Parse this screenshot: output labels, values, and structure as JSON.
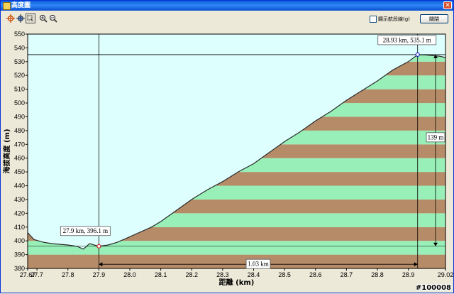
{
  "window": {
    "title": "高度圖",
    "close_glyph": "✕"
  },
  "toolbar": {
    "icons": [
      "crosshair-icon",
      "move-icon",
      "select-icon",
      "zoom-in-icon",
      "zoom-out-icon"
    ],
    "legend_checkbox_label": "顯示航段線(g)",
    "legend_checked": false,
    "close_label": "關閉"
  },
  "colors": {
    "sky": "#ddfffe",
    "band_green": "#98f0b8",
    "band_brown": "#b68c68",
    "terrain_line": "#2a2a2a",
    "frame": "#000000"
  },
  "chart_data": {
    "type": "area",
    "title": "",
    "xlabel": "距離 (km)",
    "ylabel": "海拔高度 (m)",
    "xlim": [
      27.67,
      29.02
    ],
    "ylim": [
      380,
      550
    ],
    "xticks": [
      "27.67",
      "27.7",
      "27.8",
      "27.9",
      "28.0",
      "28.1",
      "28.2",
      "28.3",
      "28.4",
      "28.5",
      "28.6",
      "28.7",
      "28.8",
      "28.9",
      "29.02"
    ],
    "xtick_values": [
      27.67,
      27.7,
      27.8,
      27.9,
      28.0,
      28.1,
      28.2,
      28.3,
      28.4,
      28.5,
      28.6,
      28.7,
      28.8,
      28.9,
      29.02
    ],
    "yticks": [
      380,
      390,
      400,
      410,
      420,
      430,
      440,
      450,
      460,
      470,
      480,
      490,
      500,
      510,
      520,
      530,
      540,
      550
    ],
    "band_step": 10,
    "series": [
      {
        "x": [
          27.67,
          27.69,
          27.72,
          27.75,
          27.8,
          27.83,
          27.85,
          27.87,
          27.9,
          27.93,
          27.96,
          28.0,
          28.03,
          28.07,
          28.1,
          28.15,
          28.2,
          28.25,
          28.3,
          28.35,
          28.4,
          28.45,
          28.5,
          28.55,
          28.6,
          28.65,
          28.7,
          28.75,
          28.8,
          28.85,
          28.9,
          28.93,
          28.95,
          29.0,
          29.02
        ],
        "y": [
          406,
          401,
          399,
          398,
          397,
          396,
          394,
          398,
          396,
          397,
          399,
          403,
          406,
          410,
          414,
          422,
          430,
          437,
          443,
          450,
          456,
          464,
          472,
          479,
          487,
          494,
          502,
          509,
          516,
          524,
          530,
          535,
          535,
          534,
          533
        ]
      }
    ],
    "annotations": {
      "point_a_label": "27.9 km, 396.1 m",
      "point_a": [
        27.9,
        396.1
      ],
      "point_b_label": "28.93 km, 535.1 m",
      "point_b": [
        28.93,
        535.1
      ],
      "horizontal_span_label": "1.03 km",
      "vertical_span_label": "139 m"
    },
    "grid": false
  },
  "watermark": "#100008"
}
